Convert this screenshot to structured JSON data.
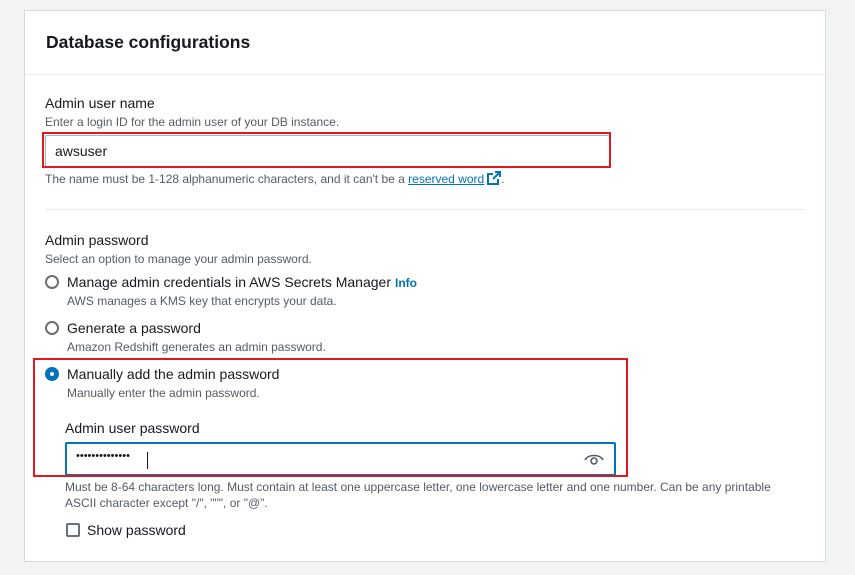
{
  "section": {
    "title": "Database configurations"
  },
  "admin_user_name": {
    "label": "Admin user name",
    "description": "Enter a login ID for the admin user of your DB instance.",
    "value": "awsuser",
    "constraint_prefix": "The name must be 1-128 alphanumeric characters, and it can't be a ",
    "constraint_link": "reserved word",
    "constraint_suffix": "."
  },
  "admin_password": {
    "label": "Admin password",
    "description": "Select an option to manage your admin password.",
    "options": [
      {
        "label": "Manage admin credentials in AWS Secrets Manager",
        "info": "Info",
        "description": "AWS manages a KMS key that encrypts your data.",
        "selected": false
      },
      {
        "label": "Generate a password",
        "description": "Amazon Redshift generates an admin password.",
        "selected": false
      },
      {
        "label": "Manually add the admin password",
        "description": "Manually enter the admin password.",
        "selected": true
      }
    ]
  },
  "admin_user_password": {
    "label": "Admin user password",
    "masked_value": "••••••••••••••",
    "constraint_line1": "Must be 8-64 characters long. Must contain at least one uppercase letter, one lowercase letter and one number. Can be any printable",
    "constraint_line2": "ASCII character except \"/\", \"\"\", or \"@\".",
    "show_password_label": "Show password",
    "show_password_checked": false
  },
  "colors": {
    "accent": "#0073bb",
    "highlight": "#e3181e",
    "border": "#aab7b8"
  },
  "icons": [
    "external-link-icon",
    "eye-icon"
  ]
}
